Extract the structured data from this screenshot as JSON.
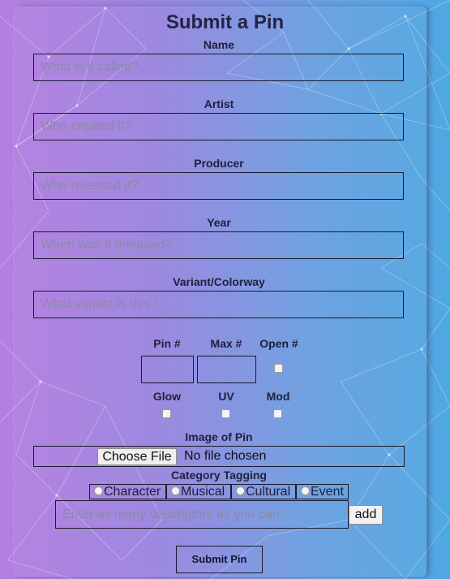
{
  "form": {
    "title": "Submit a Pin",
    "fields": [
      {
        "label": "Name",
        "placeholder": "What is it called?"
      },
      {
        "label": "Artist",
        "placeholder": "Who created it?"
      },
      {
        "label": "Producer",
        "placeholder": "Who released it?"
      },
      {
        "label": "Year",
        "placeholder": "When was it released?"
      },
      {
        "label": "Variant/Colorway",
        "placeholder": "What variant is this?"
      }
    ],
    "numbers": {
      "pin_label": "Pin #",
      "max_label": "Max #",
      "open_label": "Open #"
    },
    "flags": {
      "glow_label": "Glow",
      "uv_label": "UV",
      "mod_label": "Mod"
    },
    "image": {
      "label": "Image of Pin",
      "button": "Choose File",
      "status": "No file chosen"
    },
    "category": {
      "label": "Category Tagging",
      "options": [
        "Character",
        "Musical",
        "Cultural",
        "Event"
      ],
      "input_placeholder": "Enter as many descriptors as you can",
      "add_button": "add"
    },
    "submit_label": "Submit Pin"
  },
  "colors": {
    "gradient_left": "#b57fe0",
    "gradient_right": "#4fa8e2",
    "text": "#1f1f3f"
  }
}
